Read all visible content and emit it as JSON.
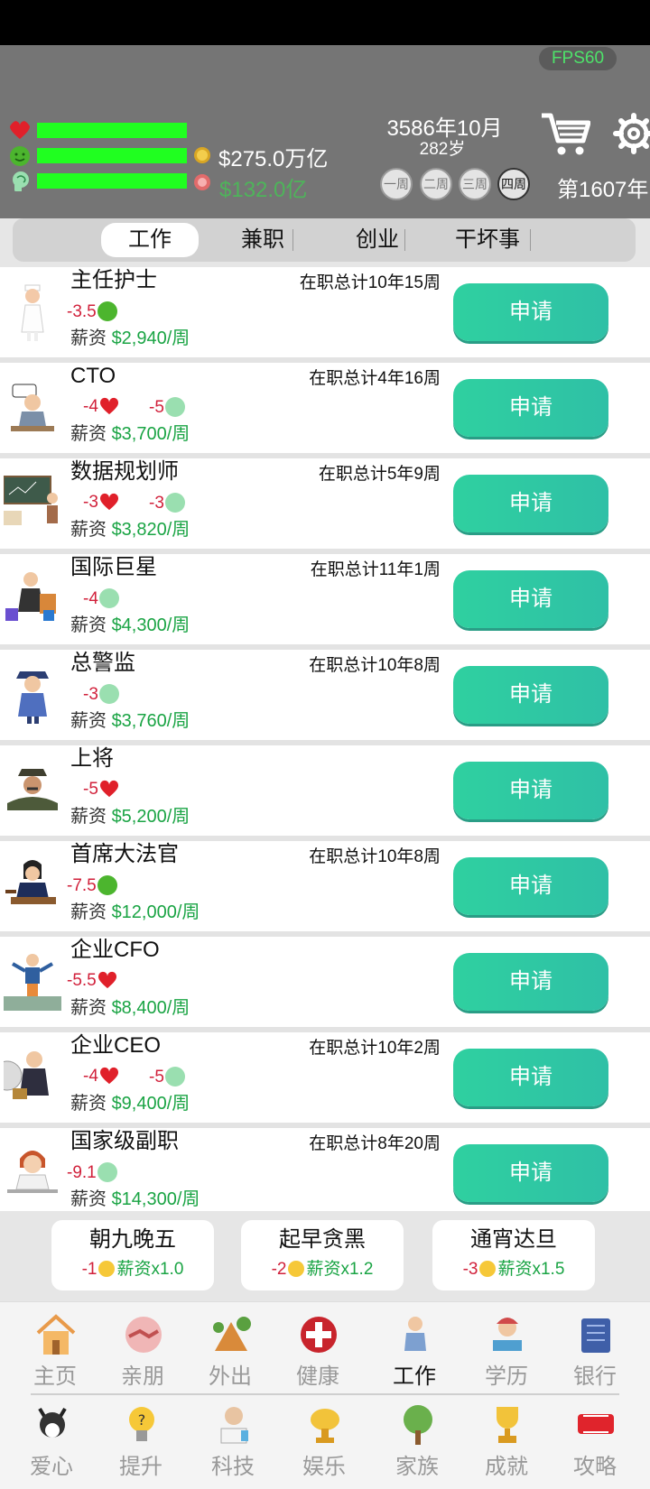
{
  "fps": "FPS60",
  "money": {
    "cash": "$275.0万亿",
    "debt": "$132.0亿"
  },
  "date": {
    "date": "3586年10月",
    "age": "282岁"
  },
  "speeds": [
    "一周",
    "二周",
    "三周",
    "四周"
  ],
  "year": "第1607年",
  "tabs": [
    "工作",
    "兼职",
    "创业",
    "干坏事"
  ],
  "apply_label": "申请",
  "jobs": [
    {
      "name": "主任护士",
      "tenure": "在职总计10年15周",
      "cost1": "-3.5",
      "cost2": "",
      "salary_label": "薪资",
      "salary": "$2,940/周"
    },
    {
      "name": "CTO",
      "tenure": "在职总计4年16周",
      "cost1": "-4",
      "cost2": "-5",
      "salary_label": "薪资",
      "salary": "$3,700/周"
    },
    {
      "name": "数据规划师",
      "tenure": "在职总计5年9周",
      "cost1": "-3",
      "cost2": "-3",
      "salary_label": "薪资",
      "salary": "$3,820/周"
    },
    {
      "name": "国际巨星",
      "tenure": "在职总计11年1周",
      "cost1": "-4",
      "cost2": "",
      "salary_label": "薪资",
      "salary": "$4,300/周"
    },
    {
      "name": "总警监",
      "tenure": "在职总计10年8周",
      "cost1": "-3",
      "cost2": "",
      "salary_label": "薪资",
      "salary": "$3,760/周"
    },
    {
      "name": "上将",
      "tenure": "",
      "cost1": "-5",
      "cost2": "",
      "salary_label": "薪资",
      "salary": "$5,200/周"
    },
    {
      "name": "首席大法官",
      "tenure": "在职总计10年8周",
      "cost1": "-7.5",
      "cost2": "",
      "salary_label": "薪资",
      "salary": "$12,000/周"
    },
    {
      "name": "企业CFO",
      "tenure": "",
      "cost1": "-5.5",
      "cost2": "",
      "salary_label": "薪资",
      "salary": "$8,400/周"
    },
    {
      "name": "企业CEO",
      "tenure": "在职总计10年2周",
      "cost1": "-4",
      "cost2": "-5",
      "salary_label": "薪资",
      "salary": "$9,400/周"
    },
    {
      "name": "国家级副职",
      "tenure": "在职总计8年20周",
      "cost1": "-9.1",
      "cost2": "",
      "salary_label": "薪资",
      "salary": "$14,300/周"
    }
  ],
  "modes": [
    {
      "title": "朝九晚五",
      "cost": "-1",
      "mult": "薪资x1.0"
    },
    {
      "title": "起早贪黑",
      "cost": "-2",
      "mult": "薪资x1.2"
    },
    {
      "title": "通宵达旦",
      "cost": "-3",
      "mult": "薪资x1.5"
    }
  ],
  "nav_row1": [
    "主页",
    "亲朋",
    "外出",
    "健康",
    "工作",
    "学历",
    "银行"
  ],
  "nav_row2": [
    "爱心",
    "提升",
    "科技",
    "娱乐",
    "家族",
    "成就",
    "攻略"
  ],
  "colors": {
    "accent": "#2fc9a3",
    "cost": "#d1213b",
    "salary": "#1aa444",
    "stat_bar": "#20ff20"
  }
}
